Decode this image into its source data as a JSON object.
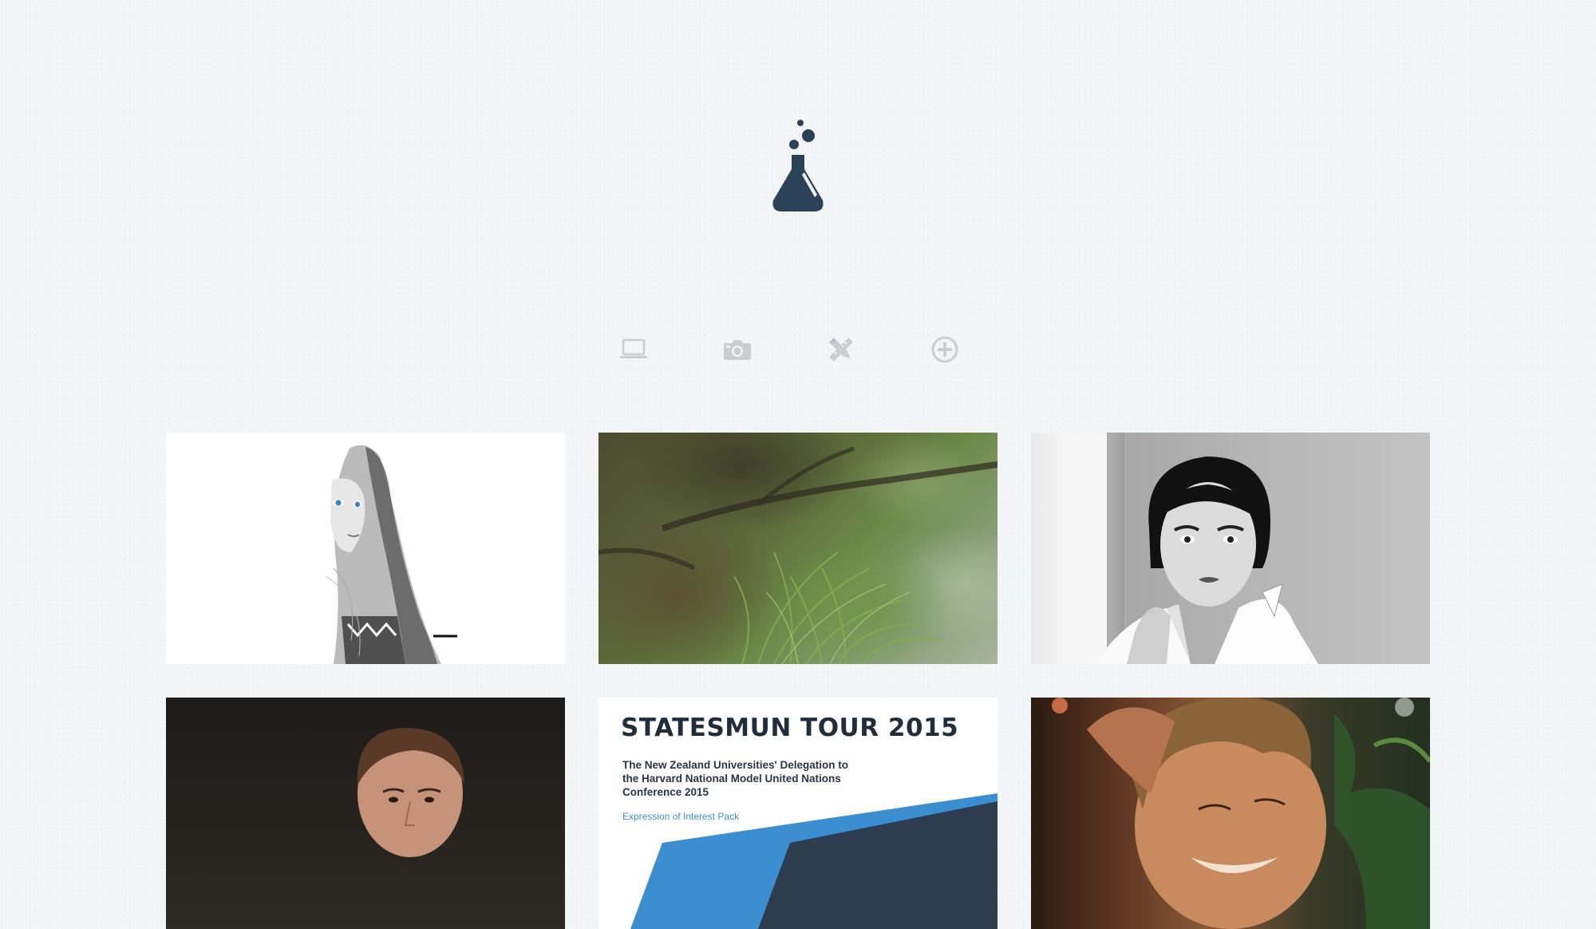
{
  "header": {
    "logo_icon": "flask-icon",
    "brand_color": "#2c4257"
  },
  "filters": [
    {
      "icon": "laptop-icon"
    },
    {
      "icon": "camera-icon"
    },
    {
      "icon": "pencil-ruler-icon"
    },
    {
      "icon": "plus-circle-icon"
    }
  ],
  "colors": {
    "filter_icon": "#c9ced3",
    "accent_blue": "#3f8fd0"
  },
  "portfolio": {
    "tiles": [
      {
        "type": "photo",
        "icon": "portrait-photo"
      },
      {
        "type": "photo",
        "icon": "forest-photo"
      },
      {
        "type": "photo",
        "icon": "portrait-photo"
      },
      {
        "type": "photo",
        "icon": "portrait-photo"
      },
      {
        "type": "document-cover",
        "title": "STATESMUN TOUR 2015",
        "subtitle": "The New Zealand Universities' Delegation to the Harvard National Model United Nations Conference 2015",
        "caption": "Expression of Interest Pack"
      },
      {
        "type": "photo",
        "icon": "portrait-photo"
      }
    ]
  }
}
